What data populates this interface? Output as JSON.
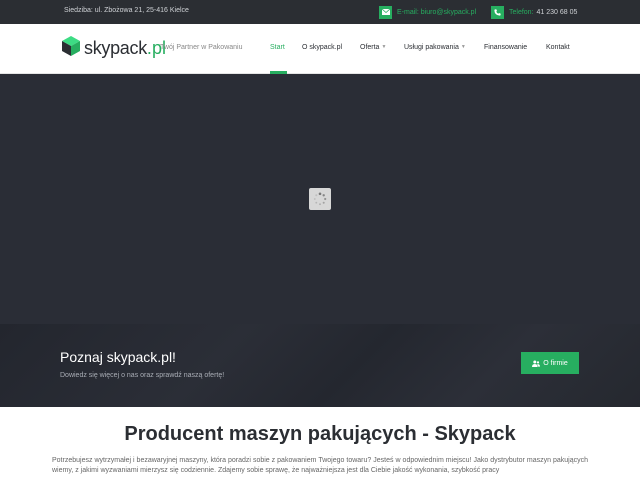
{
  "topbar": {
    "address": "Siedziba: ul. Zbożowa 21, 25-416 Kielce",
    "email_label": "E-mail:",
    "email_value": "biuro@skypack.pl",
    "phone_label": "Telefon:",
    "phone_value": "41 230 68 05",
    "icons": {
      "email": "envelope-icon",
      "phone": "phone-icon"
    }
  },
  "header": {
    "logo_name": "skypack",
    "logo_tld": "pl",
    "tagline": "Twój Partner w Pakowaniu",
    "nav": [
      {
        "label": "Start",
        "active": true
      },
      {
        "label": "O skypack.pl"
      },
      {
        "label": "Oferta",
        "has_dropdown": true
      },
      {
        "label": "Usługi pakowania",
        "has_dropdown": true
      },
      {
        "label": "Finansowanie"
      },
      {
        "label": "Kontakt"
      }
    ]
  },
  "hero": {
    "title": "Poznaj skypack.pl!",
    "subtitle": "Dowiedz się więcej o nas oraz sprawdź naszą ofertę!",
    "cta_label": "O firmie",
    "loader_icon": "spinner-icon"
  },
  "content": {
    "title": "Producent maszyn pakujących - Skypack",
    "text": "Potrzebujesz wytrzymałej i bezawaryjnej maszyny, która poradzi sobie z pakowaniem Twojego towaru? Jesteś w odpowiednim miejscu! Jako dystrybutor maszyn pakujących wiemy, z jakimi wyzwaniami mierzysz się codziennie. Zdajemy sobie sprawę, że najważniejsza jest dla Ciebie jakość wykonania, szybkość pracy"
  },
  "colors": {
    "accent": "#27ae60",
    "topbar_bg": "#2b2e33",
    "hero_bg": "#2a2d36"
  }
}
